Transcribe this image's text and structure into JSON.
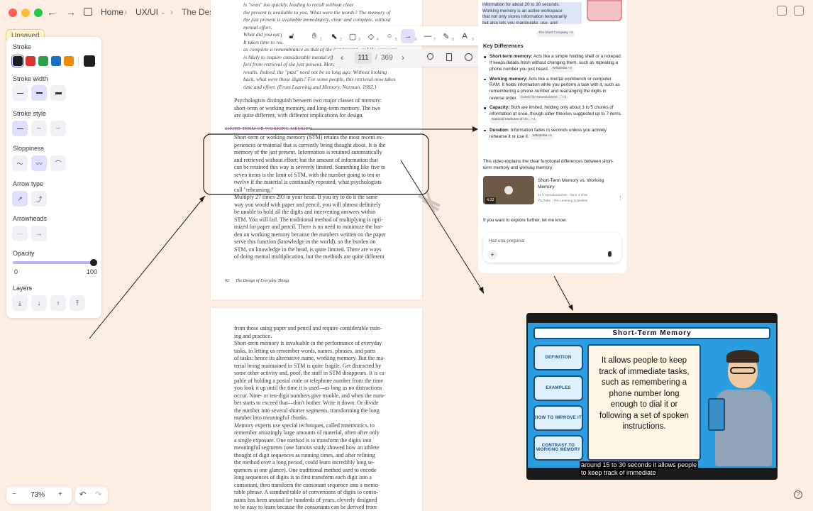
{
  "topbar": {
    "breadcrumb_home": "Home",
    "breadcrumb_folder": "UX/UI",
    "breadcrumb_doc": "The Design of Everyday Things"
  },
  "left_panel": {
    "unsaved": "Unsaved",
    "stroke": "Stroke",
    "stroke_colors": [
      "#1e1e1e",
      "#e03131",
      "#2f9e44",
      "#1971c2",
      "#f08c00"
    ],
    "stroke_current": "#1e1e1e",
    "stroke_width": "Stroke width",
    "stroke_style": "Stroke style",
    "sloppiness": "Sloppiness",
    "arrow_type": "Arrow type",
    "arrowheads": "Arrowheads",
    "opacity": "Opacity",
    "opacity_min": "0",
    "opacity_max": "100",
    "opacity_value": 100,
    "layers": "Layers"
  },
  "toolbar": {
    "lock_icon": "lock-icon",
    "keys": [
      "1",
      "2",
      "3",
      "4",
      "5",
      "6",
      "7",
      "8",
      "9",
      "0"
    ]
  },
  "pager": {
    "current_page": "111",
    "separator": "/",
    "total_pages": "369"
  },
  "page1": {
    "quote_lines": [
      "is \"seen\" too quickly, leading to recall without clear",
      "the present is available to you. What were the words? The memory of",
      "the just present is available immediately, clear and complete, without",
      "mental effort.",
      "What did you eat for dinner three days ago? Now the feeling is different.",
      "It takes time to recover the answer, which is neither as clear nor",
      "as complete a remembrance as that of the just present, and the recovery",
      "is likely to require considerable mental effort. Retrieval of the past dif-",
      "fers from retrieval of the just present. More effort is required, less clear",
      "results. Indeed, the \"past\" need not be so long ago. Without looking",
      "back, what were those digits? For some people, this retrieval now takes",
      "time and effort. (From Learning and Memory, Norman, 1982.)"
    ],
    "intro_lines": [
      "Psychologists distinguish between two major classes of memory:",
      "short-term or working memory, and long-term memory. The two",
      "are quite different, with different implications for design."
    ],
    "heading": "SHORT-TERM OR WORKING MEMORY",
    "stm_lines": [
      "Short-term or working memory (STM) retains the most recent ex-",
      "periences or material that is currently being thought about. It is the",
      "memory of the just present. Information is retained automatically",
      "and retrieved without effort; but the amount of information that",
      "can be retained this way is severely limited. Something like five to",
      "seven items is the limit of STM, with the number going to ten or",
      "twelve if the material is continually repeated, what psychologists",
      "call \"rehearsing.\""
    ],
    "multiply_lines": [
      "Multiply 27 times 293 in your head. If you try to do it the same",
      "way you would with paper and pencil, you will almost definitely",
      "be unable to hold all the digits and intervening answers within",
      "STM. You will fail. The traditional method of multiplying is opti-",
      "mized for paper and pencil. There is no need to minimize the bur-",
      "den on working memory because the numbers written on the paper",
      "serve this function (knowledge in the world), so the burden on",
      "STM, on knowledge in the head, is quite limited. There are ways",
      "of doing mental multiplication, but the methods are quite different"
    ],
    "page_number": "92",
    "running_title": "The Design of Everyday Things"
  },
  "page2": {
    "lines": [
      "from those using paper and pencil and require considerable train-",
      "ing and practice.",
      "Short-term memory is invaluable in the performance of everyday",
      "tasks, in letting us remember words, names, phrases, and parts",
      "of tasks: hence its alternative name, working memory. But the ma-",
      "terial being maintained in STM is quite fragile. Get distracted by",
      "some other activity and, poof, the stuff in STM disappears. It is ca-",
      "pable of holding a postal code or telephone number from the time",
      "you look it up until the time it is used—as long as no distractions",
      "occur. Nine- or ten-digit numbers give trouble, and when the num-",
      "ber starts to exceed that—don't bother. Write it down. Or divide",
      "the number into several shorter segments, transforming the long",
      "number into meaningful chunks.",
      "Memory experts use special techniques, called mnemonics, to",
      "remember amazingly large amounts of material, often after only",
      "a single exposure. One method is to transform the digits into",
      "meaningful segments (one famous study showed how an athlete",
      "thought of digit sequences as running times, and after refining",
      "the method over a long period, could learn incredibly long se-",
      "quences at one glance). One traditional method used to encode",
      "long sequences of digits is to first transform each digit into a",
      "consonant, then transform the consonant sequence into a memo-",
      "rable phrase. A standard table of conversions of digits to conso-",
      "nants has been around for hundreds of years, cleverly designed",
      "to be easy to learn because the consonants can be derived from"
    ]
  },
  "chat": {
    "top_highlight_1": "information for about 20 to 30 seconds.",
    "top_highlight_2": "Working memory is an active workspace",
    "top_highlight_3": "that not only stores information temporarily",
    "top_highlight_4": "but also lets you manipulate, use, and",
    "top_chip": "The Mind Company +2",
    "key_diff_heading": "Key Differences",
    "bullets": [
      {
        "title": "Short-term memory:",
        "text": " Acts like a simple holding shelf or a notepad. It keeps details fresh without changing them, such as repeating a phone number you just heard.",
        "chip": "Wikipedia +2"
      },
      {
        "title": "Working memory:",
        "text": " Acts like a mental workbench or computer RAM. It holds information while you perform a task with it, such as remembering a phone number and rearranging the digits in reverse order.",
        "chip": "Centre for Neuroscience ... +1"
      },
      {
        "title": "Capacity:",
        "text": " Both are limited, holding only about 3 to 5 chunks of information at once, though older theories suggested up to 7 items.",
        "chip": "National Institutes of He... +1"
      },
      {
        "title": "Duration:",
        "text": " Information fades in seconds unless you actively rehearse it or use it.",
        "chip": "Wikipedia +1"
      }
    ],
    "video_intro": "This video explains the clear functional differences between short-term memory and working memory:",
    "video_title": "Short-Term Memory vs. Working Memory",
    "video_meta": "21 k reproducciones · hace 4 años",
    "video_channel": "YouTube · The Learning Scientists",
    "video_duration": "4:32",
    "explore": "If you want to explore further, let me know:",
    "ask_placeholder": "Haz una pregunta"
  },
  "video": {
    "title": "Short-Term Memory",
    "buttons": [
      "DEFINITION",
      "EXAMPLES",
      "HOW TO IMPROVE IT",
      "CONTRAST TO WORKING MEMORY"
    ],
    "board_lines": [
      "It allows people to keep",
      "track of immediate tasks,",
      "such as remembering a",
      "phone number long",
      "enough to dial it or",
      "following a set of spoken",
      "instructions."
    ],
    "caption_1": "around 15 to 30 seconds it allows people",
    "caption_2": "to keep track of immediate"
  },
  "bottom": {
    "zoom_out": "−",
    "zoom": "73%",
    "zoom_in": "+"
  }
}
